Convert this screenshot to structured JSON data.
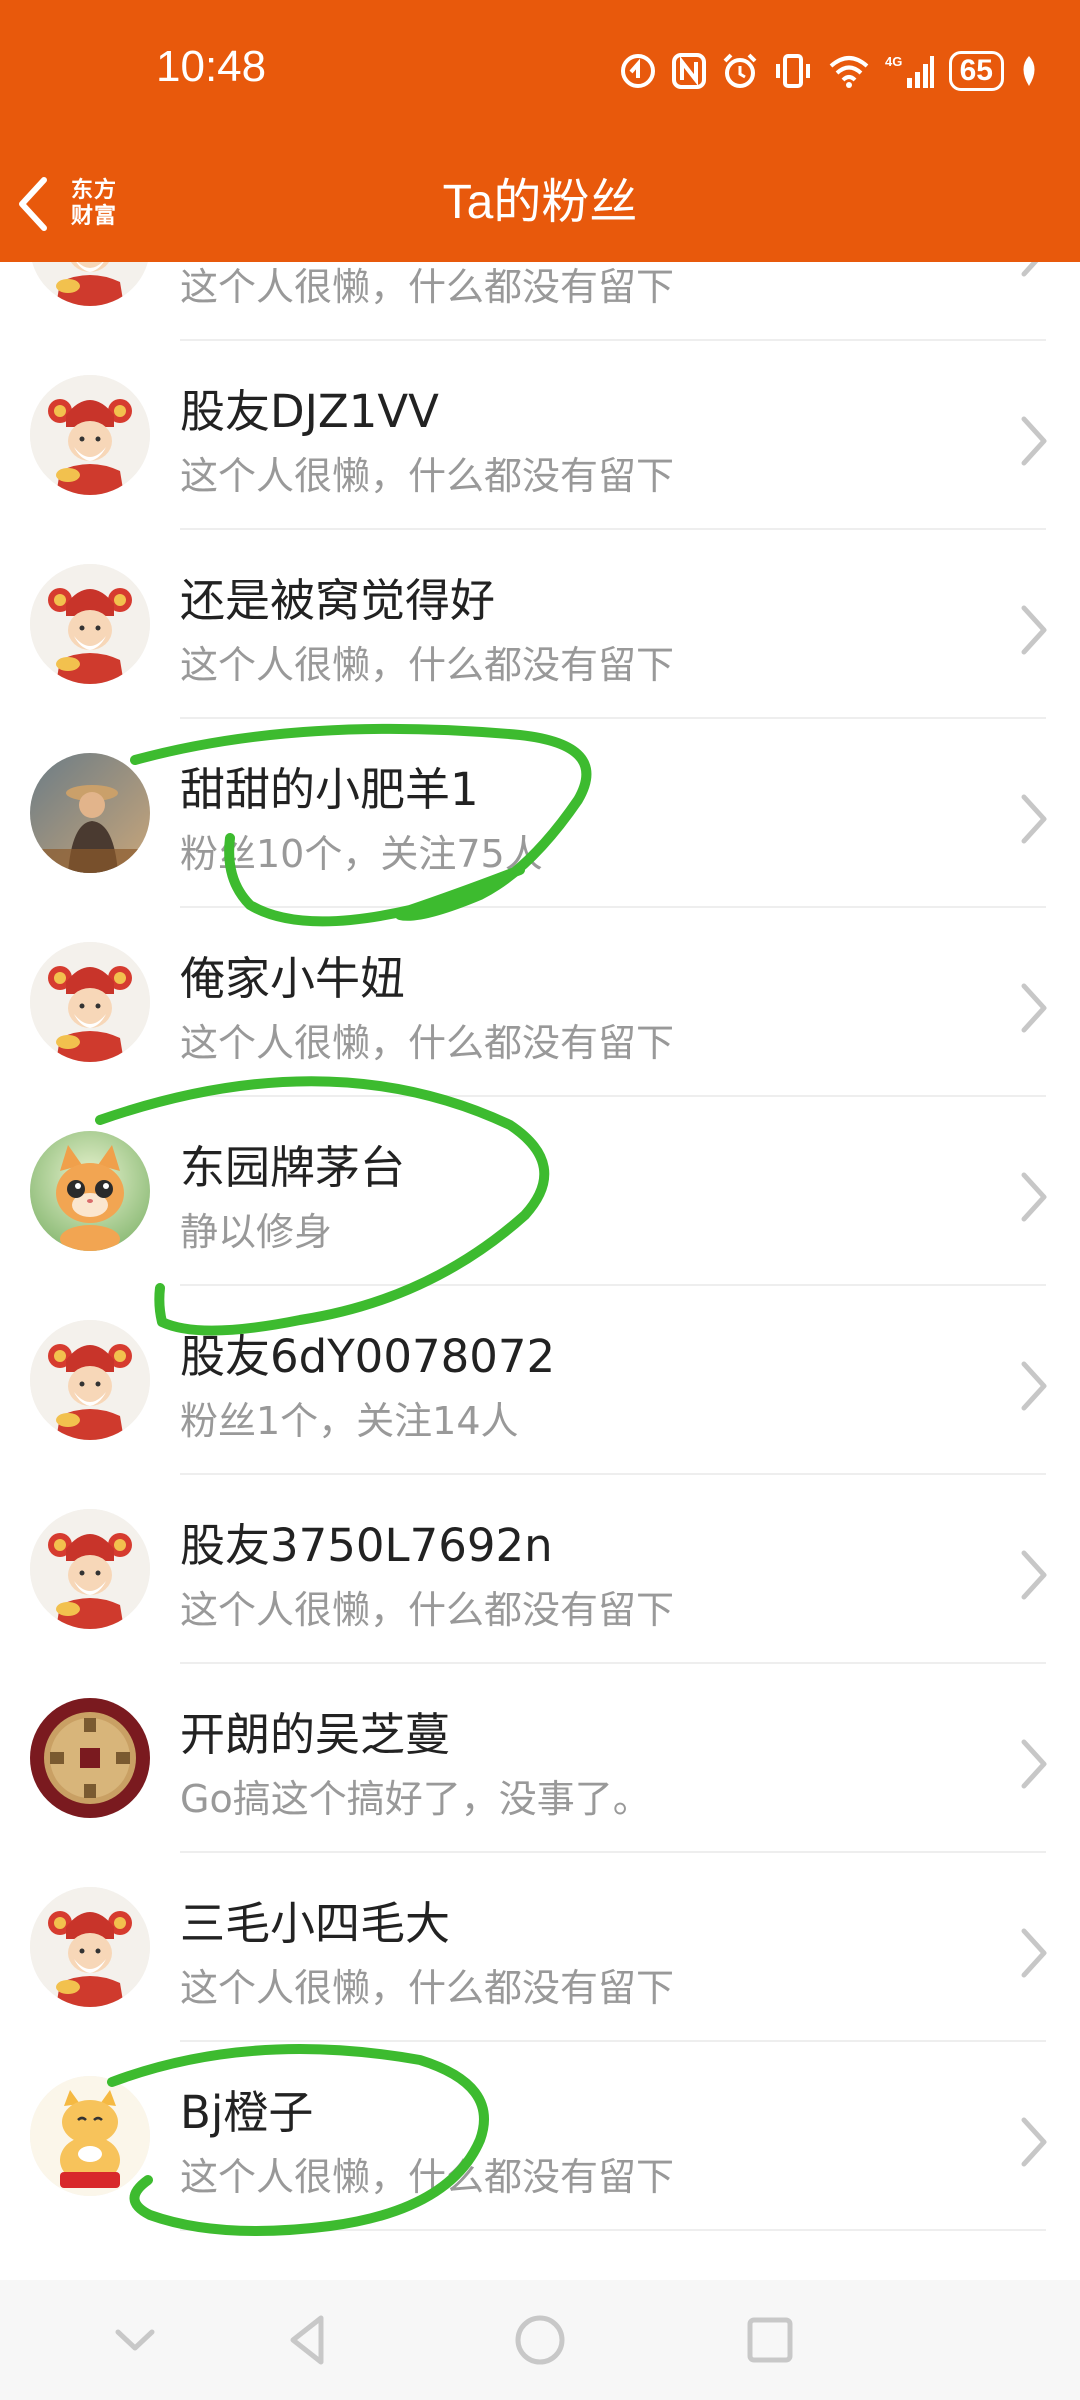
{
  "status_bar": {
    "time": "10:48",
    "battery": "65",
    "network": "4G"
  },
  "header": {
    "title": "Ta的粉丝",
    "logo_line1": "东方",
    "logo_line2": "财富"
  },
  "colors": {
    "brand": "#E8590C",
    "annotation": "#3DBB2F"
  },
  "fans": [
    {
      "name": "",
      "subtitle": "这个人很懒，什么都没有留下",
      "avatar": "fortune-god-avatar"
    },
    {
      "name": "股友DJZ1VV",
      "subtitle": "这个人很懒，什么都没有留下",
      "avatar": "fortune-god-avatar"
    },
    {
      "name": "还是被窝觉得好",
      "subtitle": "这个人很懒，什么都没有留下",
      "avatar": "fortune-god-avatar"
    },
    {
      "name": "甜甜的小肥羊1",
      "subtitle": "粉丝10个，关注75人",
      "avatar": "photo-avatar"
    },
    {
      "name": "俺家小牛妞",
      "subtitle": "这个人很懒，什么都没有留下",
      "avatar": "fortune-god-avatar"
    },
    {
      "name": "东园牌茅台",
      "subtitle": "静以修身",
      "avatar": "cartoon-cat-avatar"
    },
    {
      "name": "股友6dY0078072",
      "subtitle": "粉丝1个，关注14人",
      "avatar": "fortune-god-avatar"
    },
    {
      "name": "股友3750L7692n",
      "subtitle": "这个人很懒，什么都没有留下",
      "avatar": "fortune-god-avatar"
    },
    {
      "name": "开朗的吴芝蔓",
      "subtitle": "Go搞这个搞好了，没事了。",
      "avatar": "coin-avatar"
    },
    {
      "name": "三毛小四毛大",
      "subtitle": "这个人很懒，什么都没有留下",
      "avatar": "fortune-god-avatar"
    },
    {
      "name": "Bj橙子",
      "subtitle": "这个人很懒，什么都没有留下",
      "avatar": "lucky-cat-avatar"
    }
  ]
}
